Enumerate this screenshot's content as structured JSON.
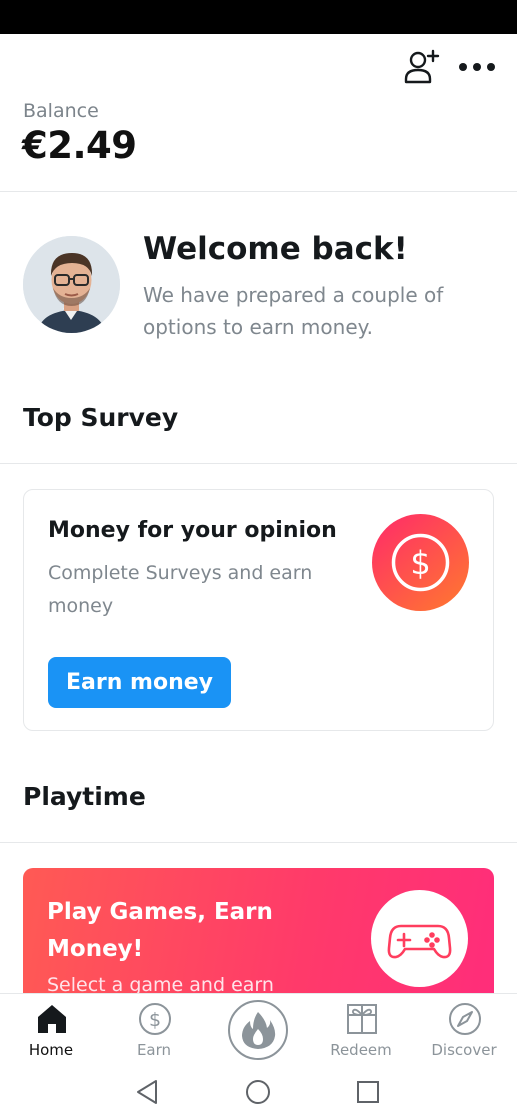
{
  "header": {
    "balance_label": "Balance",
    "balance_value": "€2.49",
    "icons": [
      "add-friend-icon",
      "more-icon"
    ]
  },
  "welcome": {
    "title": "Welcome back!",
    "text": "We have prepared a couple of options to earn money."
  },
  "top_survey": {
    "section_title": "Top Survey",
    "card_title": "Money for your opinion",
    "card_text": "Complete Surveys and earn money",
    "button_label": "Earn money",
    "icon": "dollar-icon"
  },
  "playtime": {
    "section_title": "Playtime",
    "card_title": "Play Games, Earn Money!",
    "card_text": "Select a game and earn",
    "icon": "gamepad-icon"
  },
  "nav": {
    "items": [
      {
        "label": "Home",
        "icon": "home-icon"
      },
      {
        "label": "Earn",
        "icon": "dollar-icon"
      },
      {
        "label": "",
        "icon": "flame-icon"
      },
      {
        "label": "Redeem",
        "icon": "gift-icon"
      },
      {
        "label": "Discover",
        "icon": "compass-icon"
      }
    ]
  },
  "colors": {
    "accent": "#1a93f5",
    "gradient_start": "#ff2a6a",
    "gradient_end": "#ff7a2e",
    "muted_text": "#7f878e"
  }
}
